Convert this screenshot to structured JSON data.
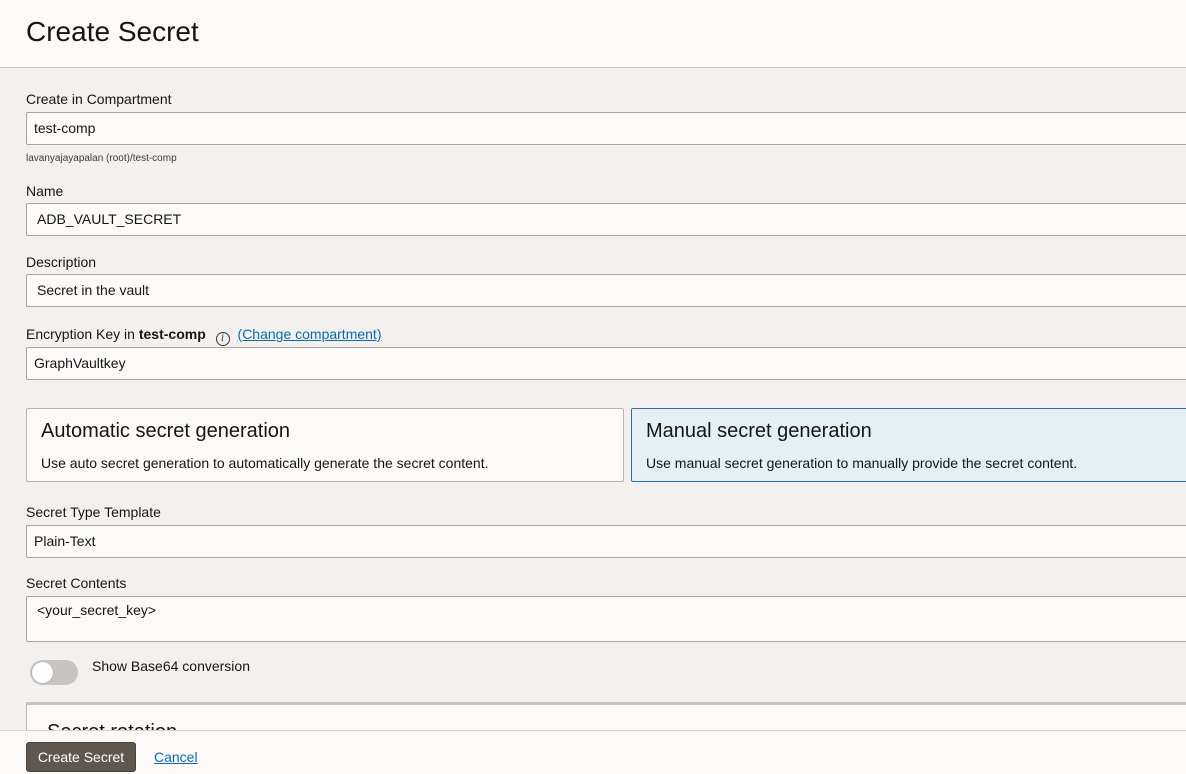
{
  "header": {
    "title": "Create Secret"
  },
  "form": {
    "compartment": {
      "label": "Create in Compartment",
      "value": "test-comp",
      "hint": "lavanyajayapalan (root)/test-comp"
    },
    "name": {
      "label": "Name",
      "value": "ADB_VAULT_SECRET"
    },
    "description": {
      "label": "Description",
      "value": "Secret in the vault"
    },
    "encryption_key": {
      "label_prefix": "Encryption Key in",
      "compartment": "test-comp",
      "info_icon": "i",
      "change_link": "(Change compartment)",
      "value": "GraphVaultkey"
    },
    "generation": {
      "automatic": {
        "title": "Automatic secret generation",
        "description": "Use auto secret generation to automatically generate the secret content.",
        "selected": false
      },
      "manual": {
        "title": "Manual secret generation",
        "description": "Use manual secret generation to manually provide the secret content.",
        "selected": true
      }
    },
    "secret_type": {
      "label": "Secret Type Template",
      "value": "Plain-Text"
    },
    "secret_contents": {
      "label": "Secret Contents",
      "value": "<your_secret_key>"
    },
    "base64_toggle": {
      "label": "Show Base64 conversion",
      "on": false
    },
    "rotation_section": {
      "title": "Secret rotation"
    }
  },
  "footer": {
    "create_label": "Create Secret",
    "cancel_label": "Cancel"
  },
  "colors": {
    "accent_link": "#0b6aa8",
    "selected_card_bg": "#e4f0f4",
    "primary_button": "#5d5750"
  }
}
